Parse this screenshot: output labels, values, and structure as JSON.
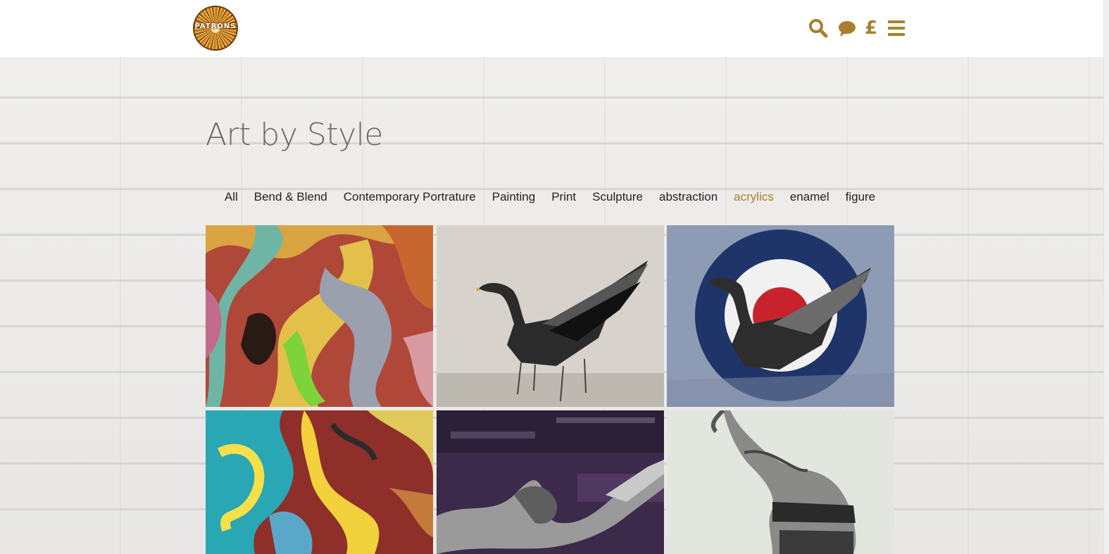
{
  "header": {
    "logo_text": "PATRONS",
    "icons": [
      "search-icon",
      "chat-bubble-icon",
      "pound-icon",
      "menu-icon"
    ],
    "pound_symbol": "£",
    "accent_color": "#a8802c"
  },
  "main": {
    "title": "Art by Style",
    "filters": [
      {
        "label": "All"
      },
      {
        "label": "Bend & Blend"
      },
      {
        "label": "Contemporary Portrature"
      },
      {
        "label": "Painting"
      },
      {
        "label": "Print"
      },
      {
        "label": "Sculpture"
      },
      {
        "label": "abstraction"
      },
      {
        "label": "acrylics"
      },
      {
        "label": "enamel"
      },
      {
        "label": "figure"
      }
    ],
    "active_filter": "acrylics",
    "artworks": [
      {
        "subject": "colorful-abstract-swirl"
      },
      {
        "subject": "swan-wings-grey"
      },
      {
        "subject": "swan-roundel"
      },
      {
        "subject": "colorful-abstract-marble"
      },
      {
        "subject": "figure-purple-abstract"
      },
      {
        "subject": "figure-back-sketch"
      }
    ]
  }
}
